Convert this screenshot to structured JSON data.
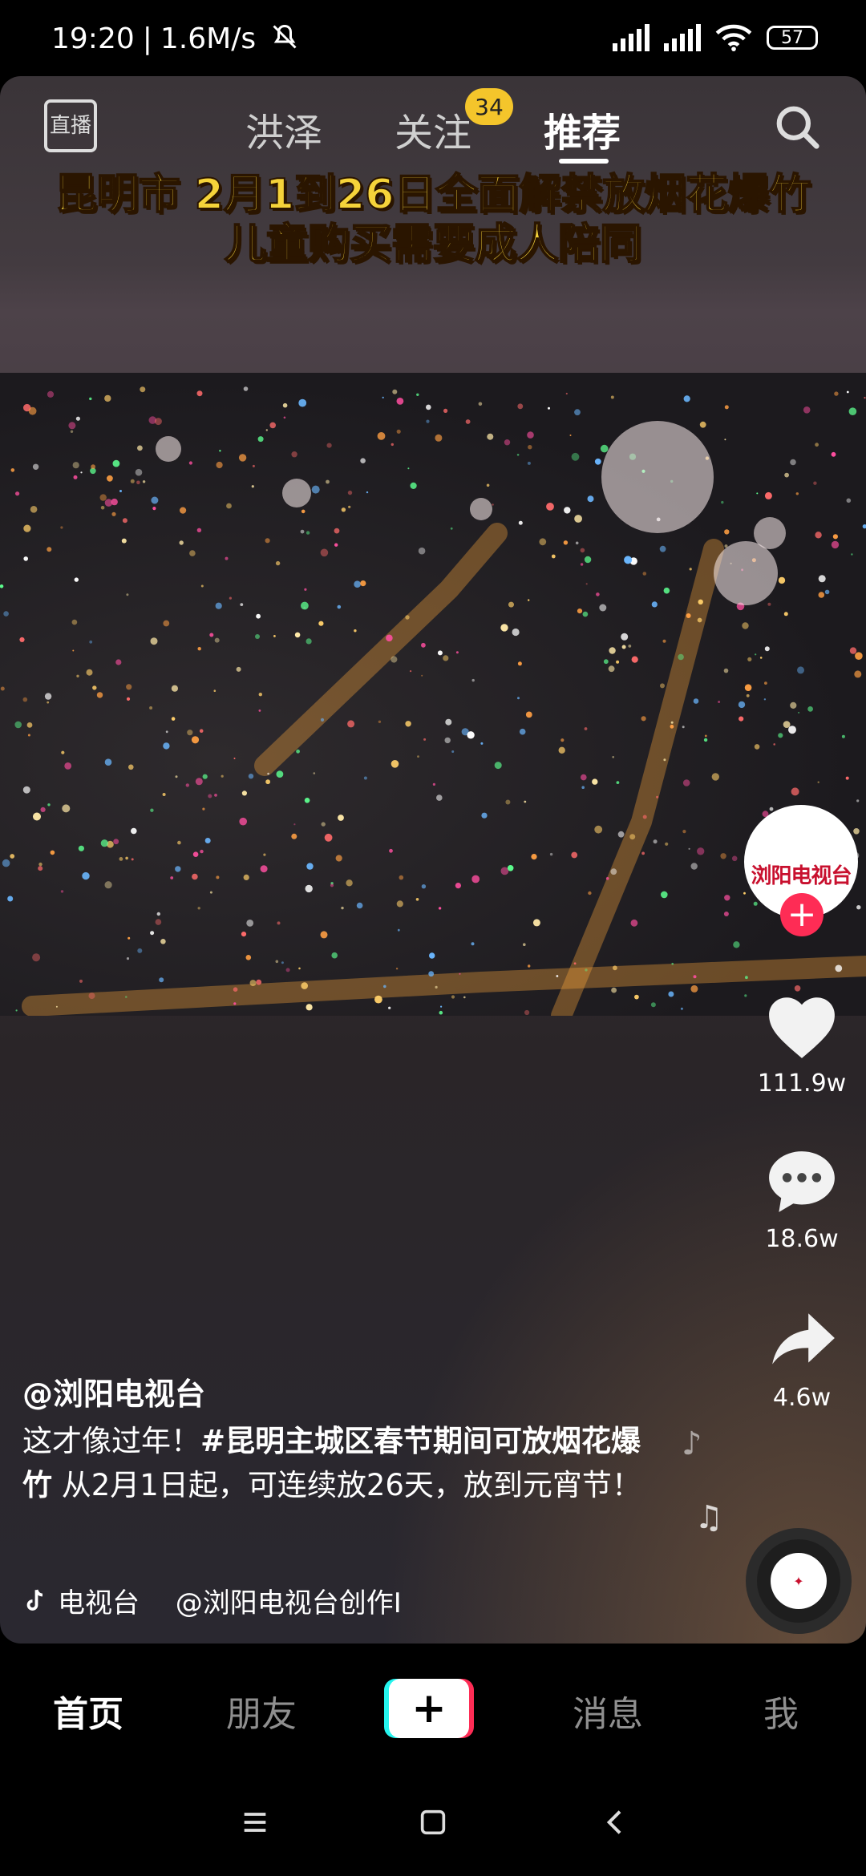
{
  "status_bar": {
    "time": "19:20",
    "network_speed": "1.6M/s",
    "battery": "57",
    "mute_icon": "bell-off-icon",
    "signal_icons": [
      "signal-icon",
      "signal-icon"
    ],
    "wifi_icon": "wifi-icon"
  },
  "top_nav": {
    "live_label": "直播",
    "tabs": [
      {
        "label": "洪泽"
      },
      {
        "label": "关注",
        "badge": "34"
      },
      {
        "label": "推荐"
      }
    ],
    "search_icon": "search-icon"
  },
  "video": {
    "caption_line1": "昆明市 2月1到26日全面解禁放烟花爆竹",
    "caption_line2": "儿童购买需要成人陪同"
  },
  "right_rail": {
    "avatar_text": "浏阳电视台",
    "like_count": "111.9w",
    "comment_count": "18.6w",
    "share_count": "4.6w"
  },
  "post": {
    "author": "@浏阳电视台",
    "desc_prefix": "这才像过年！",
    "desc_tag": "#昆明主城区春节期间可放烟花爆竹",
    "desc_suffix": " 从2月1日起，可连续放26天，放到元宵节！",
    "music_text": "电视台　 @浏阳电视台创作I"
  },
  "bottom_nav": {
    "items": [
      "首页",
      "朋友",
      "消息",
      "我"
    ],
    "create_label": "+"
  },
  "colors": {
    "accent_red": "#fe2c55",
    "accent_cyan": "#25f4ee",
    "caption_yellow": "#f5d33a",
    "badge_yellow": "#f4c52b"
  }
}
